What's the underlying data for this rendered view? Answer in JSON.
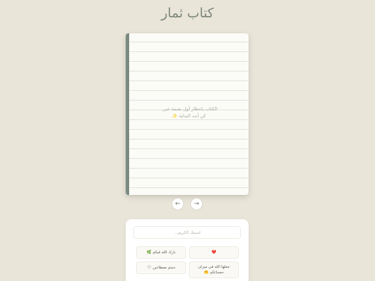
{
  "page": {
    "title": "كتاب ثمار"
  },
  "book": {
    "line1": "الكتاب بانتظار أول بصمة خير..",
    "line2": "كن أنت البداية ✨"
  },
  "nav": {
    "prev": "←",
    "next": "→"
  },
  "form": {
    "name_placeholder": "اسمك الكريم..."
  },
  "messages": [
    "❤️",
    "بارك الله فيكم 🌿",
    "جعلها الله في ميزان حسناتكم 🤲",
    "دمتم معطاءين 🤍"
  ],
  "colors": {
    "background": "#e9e5d9",
    "spine": "#7b8a81",
    "title": "#7e877c"
  }
}
